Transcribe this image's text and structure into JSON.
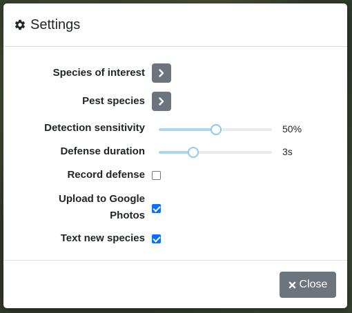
{
  "modal": {
    "title": "Settings",
    "title_icon": "gear-icon"
  },
  "settings": {
    "species_of_interest": {
      "label": "Species of interest",
      "icon": "chevron-right-icon"
    },
    "pest_species": {
      "label": "Pest species",
      "icon": "chevron-right-icon"
    },
    "detection_sensitivity": {
      "label": "Detection sensitivity",
      "value_text": "50%",
      "level": 0.5
    },
    "defense_duration": {
      "label": "Defense duration",
      "value_text": "3s",
      "level": 0.3
    },
    "record_defense": {
      "label": "Record defense",
      "checked": false
    },
    "upload_google_photos": {
      "label": "Upload to Google Photos",
      "checked": true
    },
    "text_new_species": {
      "label": "Text new species",
      "checked": true
    }
  },
  "footer": {
    "close_label": "Close",
    "close_icon": "times-icon"
  },
  "colors": {
    "button_gray": "#6c757d",
    "checkbox_blue": "#0d6efd",
    "slider_fill": "#a7d8f0"
  }
}
